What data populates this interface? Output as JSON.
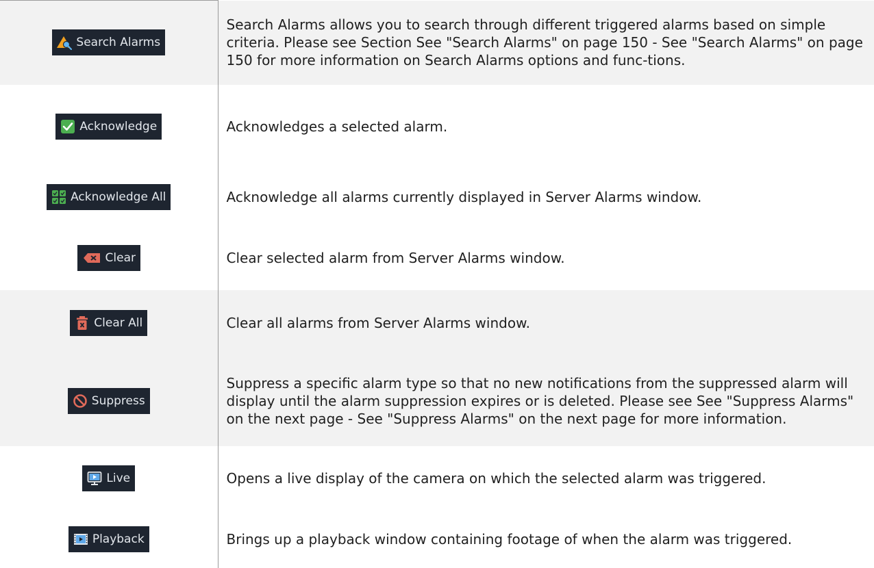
{
  "rows": [
    {
      "button_label": "Search Alarms",
      "icon": "search-alarms-icon",
      "description": "Search Alarms allows you to search through different triggered alarms based on simple criteria. Please see Section See \"Search Alarms\" on page 150 - See \"Search Alarms\" on page 150 for more information on Search Alarms options and func-tions."
    },
    {
      "button_label": "Acknowledge",
      "icon": "checkmark-icon",
      "description": "Acknowledges a selected alarm."
    },
    {
      "button_label": "Acknowledge All",
      "icon": "checkmark-grid-icon",
      "description": "Acknowledge all alarms currently displayed in Server Alarms window."
    },
    {
      "button_label": "Clear",
      "icon": "backspace-icon",
      "description": "Clear selected alarm from Server Alarms window."
    },
    {
      "button_label": "Clear All",
      "icon": "trash-icon",
      "description": "Clear all alarms from Server Alarms window."
    },
    {
      "button_label": "Suppress",
      "icon": "prohibited-icon",
      "description": "Suppress a specific alarm type so that no new notifications from the suppressed alarm will display until the alarm suppression expires or is deleted. Please see See \"Suppress Alarms\" on the next page - See \"Suppress Alarms\" on the next page for more information."
    },
    {
      "button_label": "Live",
      "icon": "monitor-play-icon",
      "description": "Opens a live display of the camera on which the selected alarm was triggered."
    },
    {
      "button_label": "Playback",
      "icon": "film-play-icon",
      "description": "Brings up a playback window containing footage of when the alarm was triggered."
    }
  ],
  "colors": {
    "button_bg": "#1e2530",
    "button_text": "#e3e7ec",
    "row_shade": "#f2f2f2",
    "check_green": "#4caf50",
    "clear_red": "#e06a5a",
    "media_blue": "#5fa8e8"
  }
}
